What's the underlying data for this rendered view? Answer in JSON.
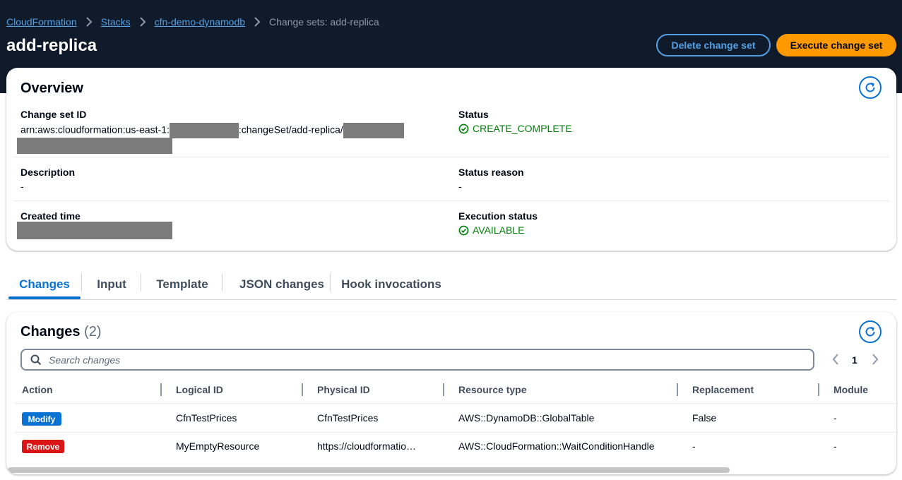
{
  "breadcrumb": {
    "items": [
      "CloudFormation",
      "Stacks",
      "cfn-demo-dynamodb"
    ],
    "current": "Change sets: add-replica"
  },
  "header": {
    "title": "add-replica",
    "delete_label": "Delete change set",
    "execute_label": "Execute change set"
  },
  "overview": {
    "title": "Overview",
    "change_set_id_label": "Change set ID",
    "change_set_id_prefix": "arn:aws:cloudformation:us-east-1:",
    "change_set_id_middle": ":changeSet/add-replica/",
    "status_label": "Status",
    "status_value": "CREATE_COMPLETE",
    "description_label": "Description",
    "description_value": "-",
    "status_reason_label": "Status reason",
    "status_reason_value": "-",
    "created_time_label": "Created time",
    "execution_status_label": "Execution status",
    "execution_status_value": "AVAILABLE"
  },
  "tabs": [
    "Changes",
    "Input",
    "Template",
    "JSON changes",
    "Hook invocations"
  ],
  "changes": {
    "title": "Changes",
    "count": "(2)",
    "search_placeholder": "Search changes",
    "page": "1",
    "columns": [
      "Action",
      "Logical ID",
      "Physical ID",
      "Resource type",
      "Replacement",
      "Module"
    ],
    "rows": [
      {
        "action": "Modify",
        "logical_id": "CfnTestPrices",
        "physical_id": "CfnTestPrices",
        "resource_type": "AWS::DynamoDB::GlobalTable",
        "replacement": "False",
        "module": "-"
      },
      {
        "action": "Remove",
        "logical_id": "MyEmptyResource",
        "physical_id": "https://cloudformatio…",
        "resource_type": "AWS::CloudFormation::WaitConditionHandle",
        "replacement": "-",
        "module": "-"
      }
    ]
  },
  "colors": {
    "header_bg": "#0f1b2a",
    "link": "#539fe5",
    "primary_button": "#ff9900",
    "accent": "#0972d3",
    "success": "#037f0c",
    "modify_badge": "#0972d3",
    "remove_badge": "#d91515"
  }
}
